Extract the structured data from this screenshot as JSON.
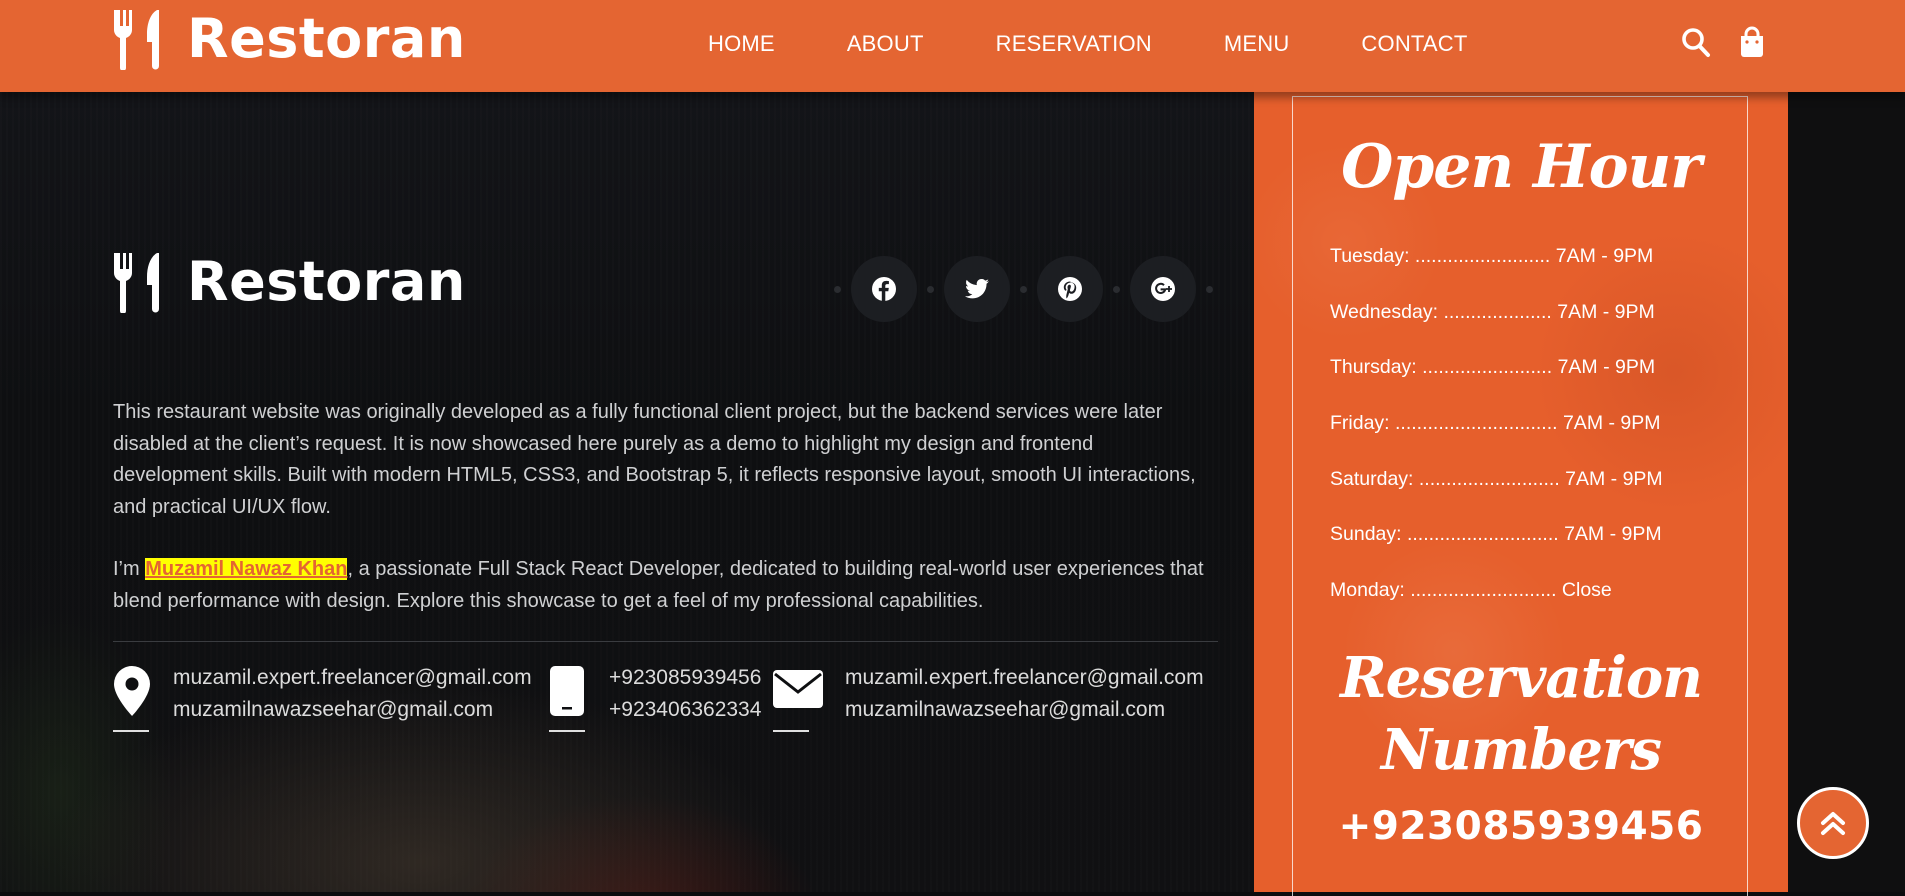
{
  "colors": {
    "primary": "#e46532",
    "highlight": "#ffff00",
    "text_light": "#cfd0d2"
  },
  "navbar": {
    "brand": "Restoran",
    "links": [
      "HOME",
      "ABOUT",
      "RESERVATION",
      "MENU",
      "CONTACT"
    ],
    "icons": [
      "search-icon",
      "shopping-bag-icon"
    ]
  },
  "footer": {
    "brand": "Restoran",
    "social": [
      "facebook-icon",
      "twitter-icon",
      "pinterest-icon",
      "google-plus-icon"
    ],
    "about": {
      "p1": "This restaurant website was originally developed as a fully functional client project, but the backend services were later disabled at the client’s request. It is now showcased here purely as a demo to highlight my design and frontend development skills. Built with modern HTML5, CSS3, and Bootstrap 5, it reflects responsive layout, smooth UI interactions, and practical UI/UX flow.",
      "p2_prefix": "I’m ",
      "p2_name": "Muzamil Nawaz Khan",
      "p2_suffix": ", a passionate Full Stack React Developer, dedicated to building real-world user experiences that blend performance with design. Explore this showcase to get a feel of my professional capabilities."
    },
    "contacts": [
      {
        "icon": "location-pin-icon",
        "lines": [
          "muzamil.expert.freelancer@gmail.com",
          "muzamilnawazseehar@gmail.com"
        ]
      },
      {
        "icon": "phone-icon",
        "lines": [
          "+923085939456",
          "+923406362334"
        ]
      },
      {
        "icon": "envelope-icon",
        "lines": [
          "muzamil.expert.freelancer@gmail.com",
          "muzamilnawazseehar@gmail.com"
        ]
      }
    ]
  },
  "open_hours": {
    "title": "Open Hour",
    "rows": [
      "Tuesday: ......................... 7AM - 9PM",
      "Wednesday: .................... 7AM - 9PM",
      "Thursday: ........................ 7AM - 9PM",
      "Friday: .............................. 7AM - 9PM",
      "Saturday: .......................... 7AM - 9PM",
      "Sunday: ............................ 7AM - 9PM",
      "Monday: ........................... Close"
    ],
    "reservation_title_1": "Reservation",
    "reservation_title_2": "Numbers",
    "reservation_number": "+923085939456"
  },
  "back_to_top": "double-chevron-up-icon"
}
